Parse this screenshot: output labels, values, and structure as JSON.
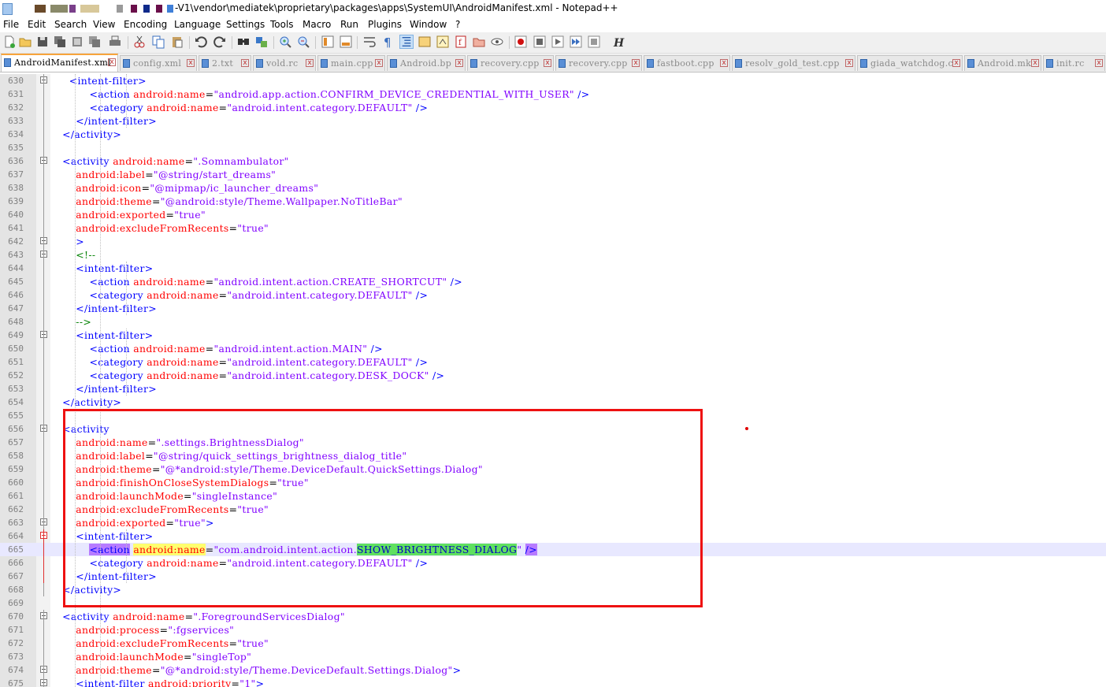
{
  "title": {
    "text": "-V1\\vendor\\mediatek\\proprietary\\packages\\apps\\SystemUI\\AndroidManifest.xml - Notepad++"
  },
  "menu": [
    "File",
    "Edit",
    "Search",
    "View",
    "Encoding",
    "Language",
    "Settings",
    "Tools",
    "Macro",
    "Run",
    "Plugins",
    "Window",
    "?"
  ],
  "tabs": [
    {
      "label": "AndroidManifest.xml",
      "active": true
    },
    {
      "label": "config.xml",
      "active": false
    },
    {
      "label": "2.txt",
      "active": false
    },
    {
      "label": "vold.rc",
      "active": false
    },
    {
      "label": "main.cpp",
      "active": false
    },
    {
      "label": "Android.bp",
      "active": false
    },
    {
      "label": "recovery.cpp",
      "active": false
    },
    {
      "label": "recovery.cpp",
      "active": false
    },
    {
      "label": "fastboot.cpp",
      "active": false
    },
    {
      "label": "resolv_gold_test.cpp",
      "active": false
    },
    {
      "label": "giada_watchdog.c",
      "active": false
    },
    {
      "label": "Android.mk",
      "active": false
    },
    {
      "label": "init.rc",
      "active": false
    }
  ],
  "tab_close_glyph": "x",
  "toolbar_icons": [
    "new-file-icon",
    "open-file-icon",
    "save-icon",
    "save-all-icon",
    "close-icon",
    "close-all-icon",
    "print-icon",
    "cut-icon",
    "copy-icon",
    "paste-icon",
    "undo-icon",
    "redo-icon",
    "find-icon",
    "replace-icon",
    "zoom-in-icon",
    "zoom-out-icon",
    "sync-vertical-icon",
    "sync-horizontal-icon",
    "word-wrap-icon",
    "show-all-chars-icon",
    "indent-guide-icon",
    "udl-icon",
    "doc-map-icon",
    "function-list-icon",
    "folder-workspace-icon",
    "monitoring-icon",
    "record-macro-icon",
    "stop-record-icon",
    "play-macro-icon",
    "run-macro-multiple-icon",
    "save-macro-icon",
    "hex-icon"
  ],
  "lines": [
    {
      "n": "630",
      "fold": "box",
      "parts": [
        [
          "  ",
          "",
          ""
        ],
        [
          "    <intent-filter>",
          "tag",
          ""
        ]
      ]
    },
    {
      "n": "631",
      "parts": [
        [
          "            <action ",
          "tag"
        ],
        [
          "android:name",
          "attr"
        ],
        [
          "=",
          "eq"
        ],
        [
          "\"android.app.action.CONFIRM_DEVICE_CREDENTIAL_WITH_USER\"",
          "val"
        ],
        [
          " />",
          "tag"
        ]
      ]
    },
    {
      "n": "632",
      "parts": [
        [
          "            <category ",
          "tag"
        ],
        [
          "android:name",
          "attr"
        ],
        [
          "=",
          "eq"
        ],
        [
          "\"android.intent.category.DEFAULT\"",
          "val"
        ],
        [
          " />",
          "tag"
        ]
      ]
    },
    {
      "n": "633",
      "parts": [
        [
          "        </intent-filter>",
          "tag"
        ]
      ]
    },
    {
      "n": "634",
      "parts": [
        [
          "    </activity>",
          "tag"
        ]
      ]
    },
    {
      "n": "635",
      "parts": []
    },
    {
      "n": "636",
      "fold": "box",
      "parts": [
        [
          "    <activity ",
          "tag"
        ],
        [
          "android:name",
          "attr"
        ],
        [
          "=",
          "eq"
        ],
        [
          "\".Somnambulator\"",
          "val"
        ]
      ]
    },
    {
      "n": "637",
      "parts": [
        [
          "        android:label",
          "attr"
        ],
        [
          "=",
          "eq"
        ],
        [
          "\"@string/start_dreams\"",
          "val"
        ]
      ]
    },
    {
      "n": "638",
      "parts": [
        [
          "        android:icon",
          "attr"
        ],
        [
          "=",
          "eq"
        ],
        [
          "\"@mipmap/ic_launcher_dreams\"",
          "val"
        ]
      ]
    },
    {
      "n": "639",
      "parts": [
        [
          "        android:theme",
          "attr"
        ],
        [
          "=",
          "eq"
        ],
        [
          "\"@android:style/Theme.Wallpaper.NoTitleBar\"",
          "val"
        ]
      ]
    },
    {
      "n": "640",
      "parts": [
        [
          "        android:exported",
          "attr"
        ],
        [
          "=",
          "eq"
        ],
        [
          "\"true\"",
          "val"
        ]
      ]
    },
    {
      "n": "641",
      "parts": [
        [
          "        android:excludeFromRecents",
          "attr"
        ],
        [
          "=",
          "eq"
        ],
        [
          "\"true\"",
          "val"
        ]
      ]
    },
    {
      "n": "642",
      "fold": "box",
      "parts": [
        [
          "        >",
          "tag"
        ]
      ]
    },
    {
      "n": "643",
      "fold": "box",
      "parts": [
        [
          "        <!--",
          "cmt"
        ]
      ]
    },
    {
      "n": "644",
      "parts": [
        [
          "        <intent-filter>",
          "tag"
        ]
      ]
    },
    {
      "n": "645",
      "parts": [
        [
          "            <action ",
          "tag"
        ],
        [
          "android:name",
          "attr"
        ],
        [
          "=",
          "eq"
        ],
        [
          "\"android.intent.action.CREATE_SHORTCUT\"",
          "val"
        ],
        [
          " />",
          "tag"
        ]
      ]
    },
    {
      "n": "646",
      "parts": [
        [
          "            <category ",
          "tag"
        ],
        [
          "android:name",
          "attr"
        ],
        [
          "=",
          "eq"
        ],
        [
          "\"android.intent.category.DEFAULT\"",
          "val"
        ],
        [
          " />",
          "tag"
        ]
      ]
    },
    {
      "n": "647",
      "parts": [
        [
          "        </intent-filter>",
          "tag"
        ]
      ]
    },
    {
      "n": "648",
      "parts": [
        [
          "        -->",
          "cmt"
        ]
      ]
    },
    {
      "n": "649",
      "fold": "box",
      "parts": [
        [
          "        <intent-filter>",
          "tag"
        ]
      ]
    },
    {
      "n": "650",
      "parts": [
        [
          "            <action ",
          "tag"
        ],
        [
          "android:name",
          "attr"
        ],
        [
          "=",
          "eq"
        ],
        [
          "\"android.intent.action.MAIN\"",
          "val"
        ],
        [
          " />",
          "tag"
        ]
      ]
    },
    {
      "n": "651",
      "parts": [
        [
          "            <category ",
          "tag"
        ],
        [
          "android:name",
          "attr"
        ],
        [
          "=",
          "eq"
        ],
        [
          "\"android.intent.category.DEFAULT\"",
          "val"
        ],
        [
          " />",
          "tag"
        ]
      ]
    },
    {
      "n": "652",
      "parts": [
        [
          "            <category ",
          "tag"
        ],
        [
          "android:name",
          "attr"
        ],
        [
          "=",
          "eq"
        ],
        [
          "\"android.intent.category.DESK_DOCK\"",
          "val"
        ],
        [
          " />",
          "tag"
        ]
      ]
    },
    {
      "n": "653",
      "parts": [
        [
          "        </intent-filter>",
          "tag"
        ]
      ]
    },
    {
      "n": "654",
      "parts": [
        [
          "    </activity>",
          "tag"
        ]
      ]
    },
    {
      "n": "655",
      "parts": []
    },
    {
      "n": "656",
      "fold": "box",
      "parts": [
        [
          "    <activity",
          "tag"
        ]
      ]
    },
    {
      "n": "657",
      "parts": [
        [
          "        android:name",
          "attr"
        ],
        [
          "=",
          "eq"
        ],
        [
          "\".settings.BrightnessDialog\"",
          "val"
        ]
      ]
    },
    {
      "n": "658",
      "parts": [
        [
          "        android:label",
          "attr"
        ],
        [
          "=",
          "eq"
        ],
        [
          "\"@string/quick_settings_brightness_dialog_title\"",
          "val"
        ]
      ]
    },
    {
      "n": "659",
      "parts": [
        [
          "        android:theme",
          "attr"
        ],
        [
          "=",
          "eq"
        ],
        [
          "\"@*android:style/Theme.DeviceDefault.QuickSettings.Dialog\"",
          "val"
        ]
      ]
    },
    {
      "n": "660",
      "parts": [
        [
          "        android:finishOnCloseSystemDialogs",
          "attr"
        ],
        [
          "=",
          "eq"
        ],
        [
          "\"true\"",
          "val"
        ]
      ]
    },
    {
      "n": "661",
      "parts": [
        [
          "        android:launchMode",
          "attr"
        ],
        [
          "=",
          "eq"
        ],
        [
          "\"singleInstance\"",
          "val"
        ]
      ]
    },
    {
      "n": "662",
      "parts": [
        [
          "        android:excludeFromRecents",
          "attr"
        ],
        [
          "=",
          "eq"
        ],
        [
          "\"true\"",
          "val"
        ]
      ]
    },
    {
      "n": "663",
      "fold": "box",
      "parts": [
        [
          "        android:exported",
          "attr"
        ],
        [
          "=",
          "eq"
        ],
        [
          "\"true\"",
          "val"
        ],
        [
          ">",
          "tag"
        ]
      ]
    },
    {
      "n": "664",
      "fold": "red",
      "parts": [
        [
          "        <intent-filter>",
          "tag"
        ]
      ]
    },
    {
      "n": "665",
      "current": true,
      "parts": [
        [
          "            ",
          ""
        ],
        [
          "<action",
          "hl-tag"
        ],
        [
          " ",
          ""
        ],
        [
          "android:name",
          "hl-attr"
        ],
        [
          "=",
          "eq"
        ],
        [
          "\"com.android.intent.action.",
          "val"
        ],
        [
          "SHOW_BRIGHTNESS_DIALOG",
          "hl-sel"
        ],
        [
          "\"",
          "val"
        ],
        [
          " ",
          ""
        ],
        [
          "/>",
          "hl-end"
        ]
      ]
    },
    {
      "n": "666",
      "parts": [
        [
          "            <category ",
          "tag"
        ],
        [
          "android:name",
          "attr"
        ],
        [
          "=",
          "eq"
        ],
        [
          "\"android.intent.category.DEFAULT\"",
          "val"
        ],
        [
          " />",
          "tag"
        ]
      ]
    },
    {
      "n": "667",
      "parts": [
        [
          "        </intent-filter>",
          "tag"
        ]
      ]
    },
    {
      "n": "668",
      "parts": [
        [
          "    </activity>",
          "tag"
        ]
      ]
    },
    {
      "n": "669",
      "parts": []
    },
    {
      "n": "670",
      "fold": "box",
      "parts": [
        [
          "    <activity ",
          "tag"
        ],
        [
          "android:name",
          "attr"
        ],
        [
          "=",
          "eq"
        ],
        [
          "\".ForegroundServicesDialog\"",
          "val"
        ]
      ]
    },
    {
      "n": "671",
      "parts": [
        [
          "        android:process",
          "attr"
        ],
        [
          "=",
          "eq"
        ],
        [
          "\":fgservices\"",
          "val"
        ]
      ]
    },
    {
      "n": "672",
      "parts": [
        [
          "        android:excludeFromRecents",
          "attr"
        ],
        [
          "=",
          "eq"
        ],
        [
          "\"true\"",
          "val"
        ]
      ]
    },
    {
      "n": "673",
      "parts": [
        [
          "        android:launchMode",
          "attr"
        ],
        [
          "=",
          "eq"
        ],
        [
          "\"singleTop\"",
          "val"
        ]
      ]
    },
    {
      "n": "674",
      "fold": "box",
      "parts": [
        [
          "        android:theme",
          "attr"
        ],
        [
          "=",
          "eq"
        ],
        [
          "\"@*android:style/Theme.DeviceDefault.Settings.Dialog\"",
          "val"
        ],
        [
          ">",
          "tag"
        ]
      ]
    },
    {
      "n": "675",
      "fold": "box",
      "parts": [
        [
          "        <intent-filter ",
          "tag"
        ],
        [
          "android:priority",
          "attr"
        ],
        [
          "=",
          "eq"
        ],
        [
          "\"1\"",
          "val"
        ],
        [
          ">",
          "tag"
        ]
      ]
    }
  ]
}
